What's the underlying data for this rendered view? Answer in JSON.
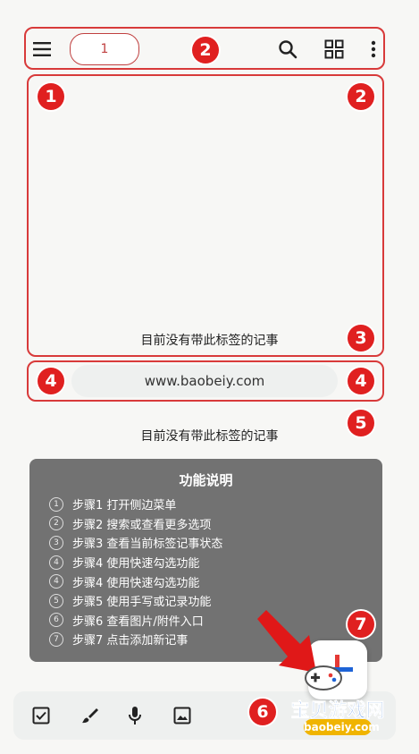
{
  "toolbar": {
    "label_chip": "1",
    "menu_icon": "hamburger-menu-icon",
    "search_icon": "search-icon",
    "grid_icon": "grid-view-icon",
    "more_icon": "more-vert-icon"
  },
  "badges": {
    "b1": "1",
    "b2a": "2",
    "b2b": "2",
    "b3": "3",
    "b4a": "4",
    "b4b": "4",
    "b5": "5",
    "b6": "6",
    "b7": "7"
  },
  "main": {
    "empty_text_1": "目前没有带此标签的记事",
    "url_text": "www.baobeiy.com",
    "empty_text_2": "目前没有带此标签的记事"
  },
  "help": {
    "title": "功能说明",
    "items": [
      {
        "num": "1",
        "text": "步骤1  打开侧边菜单"
      },
      {
        "num": "2",
        "text": "步骤2  搜索或查看更多选项"
      },
      {
        "num": "3",
        "text": "步骤3  查看当前标签记事状态"
      },
      {
        "num": "4",
        "text": "步骤4  使用快速勾选功能"
      },
      {
        "num": "4",
        "text": "步骤4  使用快速勾选功能"
      },
      {
        "num": "5",
        "text": "步骤5  使用手写或记录功能"
      },
      {
        "num": "6",
        "text": "步骤6  查看图片/附件入口"
      },
      {
        "num": "7",
        "text": "步骤7  点击添加新记事"
      }
    ]
  },
  "bottom_bar": {
    "checkbox_icon": "checkbox-icon",
    "brush_icon": "brush-icon",
    "mic_icon": "microphone-icon",
    "image_icon": "image-icon"
  },
  "watermark": {
    "title": "宝贝游戏网",
    "url": "baobeiy.com"
  },
  "colors": {
    "accent_red": "#e02020",
    "help_bg": "#727272",
    "bar_bg": "#eef0ef"
  }
}
